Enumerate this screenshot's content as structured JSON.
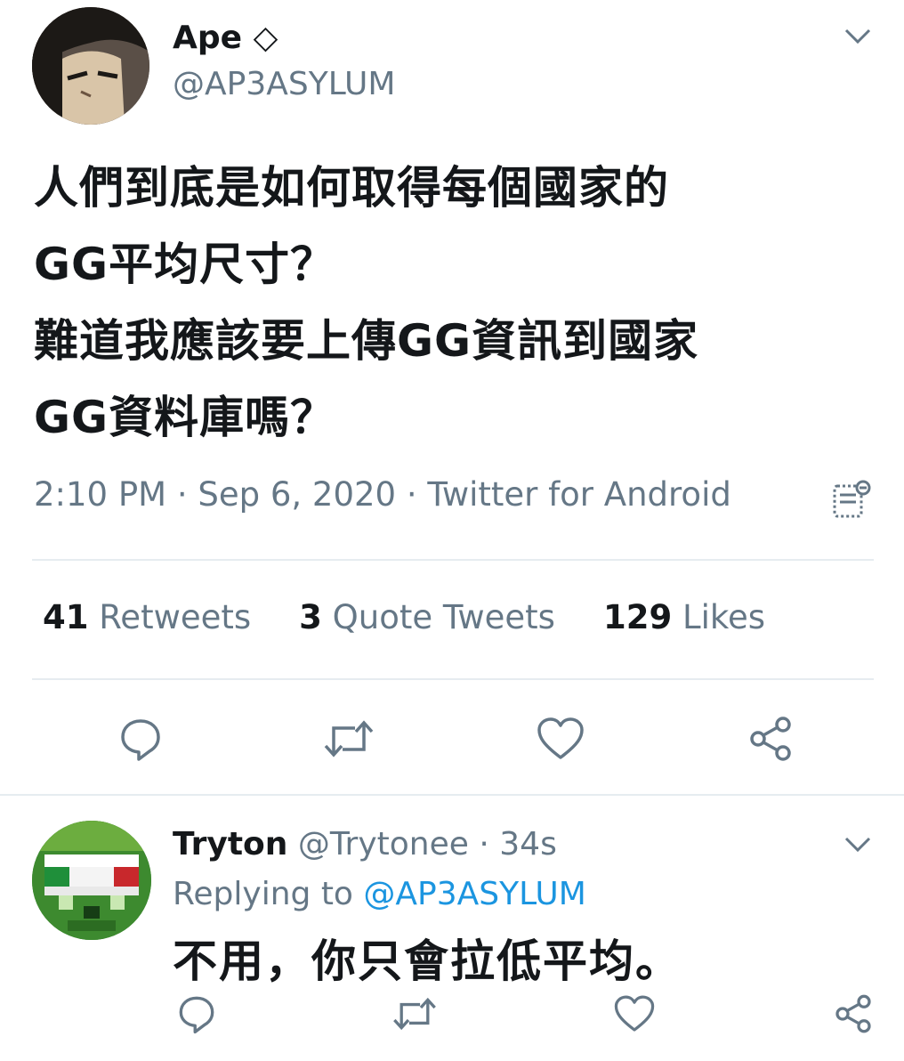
{
  "tweet": {
    "author_name": "Ape ◇",
    "author_handle": "@AP3ASYLUM",
    "text": "人們到底是如何取得每個國家的\nGG平均尺寸？\n難道我應該要上傳GG資訊到國家\nGG資料庫嗎？",
    "meta": "2:10 PM · Sep 6, 2020 · Twitter for Android",
    "stats": {
      "retweets_count": "41",
      "retweets_label": "Retweets",
      "quotes_count": "3",
      "quotes_label": "Quote Tweets",
      "likes_count": "129",
      "likes_label": "Likes"
    }
  },
  "reply": {
    "author_name": "Tryton",
    "author_handle": "@Trytonee",
    "time": "· 34s",
    "replying_prefix": "Replying to",
    "replying_handle": "@AP3ASYLUM",
    "text": "不用，你只會拉低平均。"
  },
  "icons": {
    "caret": "chevron-down-icon",
    "analytics": "analytics-icon",
    "reply": "reply-icon",
    "retweet": "retweet-icon",
    "like": "heart-icon",
    "share": "share-icon"
  },
  "colors": {
    "text": "#14171a",
    "secondary": "#657786",
    "link": "#1b95e0",
    "divider": "#e6ecf0"
  }
}
